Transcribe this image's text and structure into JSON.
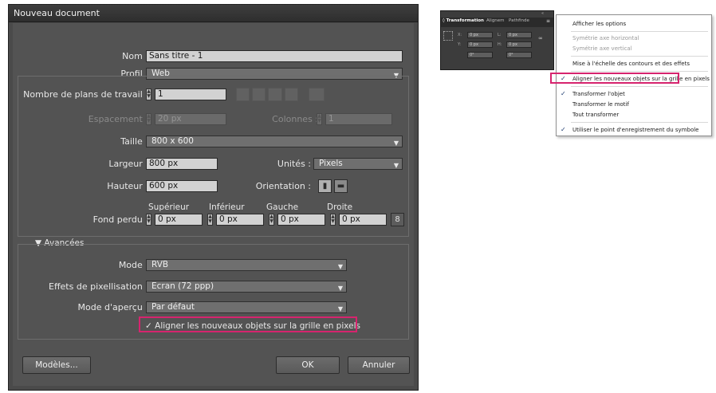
{
  "dialog": {
    "title": "Nouveau document",
    "nom": {
      "label": "Nom :",
      "value": "Sans titre - 1"
    },
    "profil": {
      "label": "Profil :",
      "value": "Web"
    },
    "plans": {
      "label": "Nombre de plans de travail :",
      "value": "1"
    },
    "espacement": {
      "label": "Espacement :",
      "value": "20 px"
    },
    "colonnes": {
      "label": "Colonnes :",
      "value": "1"
    },
    "taille": {
      "label": "Taille :",
      "value": "800 x 600"
    },
    "largeur": {
      "label": "Largeur :",
      "value": "800 px"
    },
    "unites": {
      "label": "Unités :",
      "value": "Pixels"
    },
    "hauteur": {
      "label": "Hauteur :",
      "value": "600 px"
    },
    "orientation": {
      "label": "Orientation :"
    },
    "fond_perdu": {
      "label": "Fond perdu :",
      "superieur": {
        "label": "Supérieur",
        "value": "0 px"
      },
      "inferieur": {
        "label": "Inférieur",
        "value": "0 px"
      },
      "gauche": {
        "label": "Gauche",
        "value": "0 px"
      },
      "droite": {
        "label": "Droite",
        "value": "0 px"
      }
    },
    "avancees": {
      "label": "Avancées"
    },
    "mode": {
      "label": "Mode :",
      "value": "RVB"
    },
    "effets": {
      "label": "Effets de pixellisation :",
      "value": "Ecran (72 ppp)"
    },
    "apercu": {
      "label": "Mode d'aperçu :",
      "value": "Par défaut"
    },
    "align_checkbox": {
      "label": "Aligner les nouveaux objets sur la grille en pixels",
      "checked": true
    },
    "buttons": {
      "modeles": "Modèles...",
      "ok": "OK",
      "annuler": "Annuler"
    }
  },
  "panel": {
    "tabs": [
      "◊ Transformation",
      "Alignem",
      "Pathfinde"
    ],
    "fields": [
      "0 px",
      "0 px",
      "0 px",
      "0 px",
      "0°",
      "0°"
    ],
    "field_labels": [
      "X:",
      "L:",
      "Y:",
      "H:"
    ]
  },
  "menu": {
    "items": [
      {
        "label": "Afficher les options",
        "checked": false,
        "disabled": false
      },
      {
        "label": "Symétrie axe horizontal",
        "checked": false,
        "disabled": true
      },
      {
        "label": "Symétrie axe vertical",
        "checked": false,
        "disabled": true
      },
      {
        "label": "Mise à l'échelle des contours et des effets",
        "checked": false,
        "disabled": false
      },
      {
        "label": "Aligner les nouveaux objets sur la grille en pixels",
        "checked": true,
        "disabled": false
      },
      {
        "label": "Transformer l'objet",
        "checked": true,
        "disabled": false
      },
      {
        "label": "Transformer le motif",
        "checked": false,
        "disabled": false
      },
      {
        "label": "Tout transformer",
        "checked": false,
        "disabled": false
      },
      {
        "label": "Utiliser le point d'enregistrement du symbole",
        "checked": true,
        "disabled": false
      }
    ]
  },
  "colors": {
    "highlight": "#d6246e",
    "dialog_bg": "#535353"
  }
}
